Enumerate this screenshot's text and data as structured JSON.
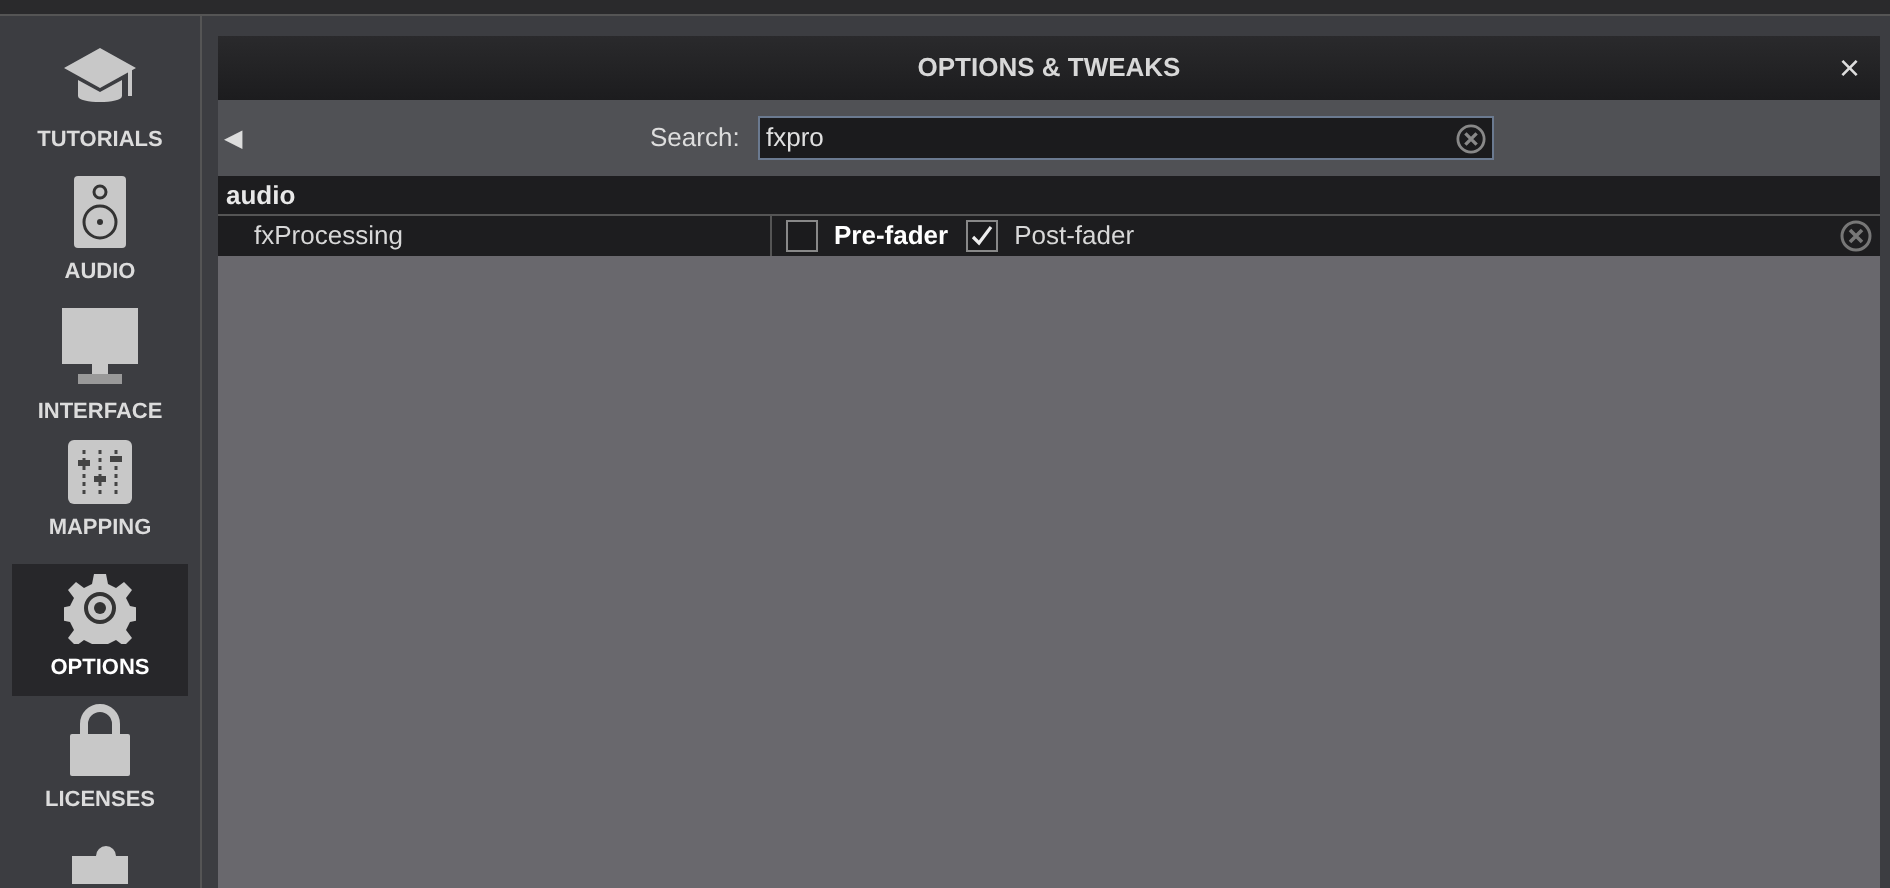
{
  "sidebar": {
    "items": [
      {
        "label": "TUTORIALS",
        "selected": false
      },
      {
        "label": "AUDIO",
        "selected": false
      },
      {
        "label": "INTERFACE",
        "selected": false
      },
      {
        "label": "MAPPING",
        "selected": false
      },
      {
        "label": "OPTIONS",
        "selected": true
      },
      {
        "label": "LICENSES",
        "selected": false
      },
      {
        "selected": false
      }
    ]
  },
  "dialog": {
    "title": "OPTIONS & TWEAKS",
    "close": "×",
    "back": "◀",
    "search": {
      "label": "Search:",
      "value": "fxpro"
    },
    "groups": [
      {
        "name": "audio",
        "rows": [
          {
            "name": "fxProcessing",
            "options": [
              {
                "label": "Pre-fader",
                "checked": false,
                "emphasized": true
              },
              {
                "label": "Post-fader",
                "checked": true,
                "emphasized": false
              }
            ]
          }
        ]
      }
    ]
  }
}
